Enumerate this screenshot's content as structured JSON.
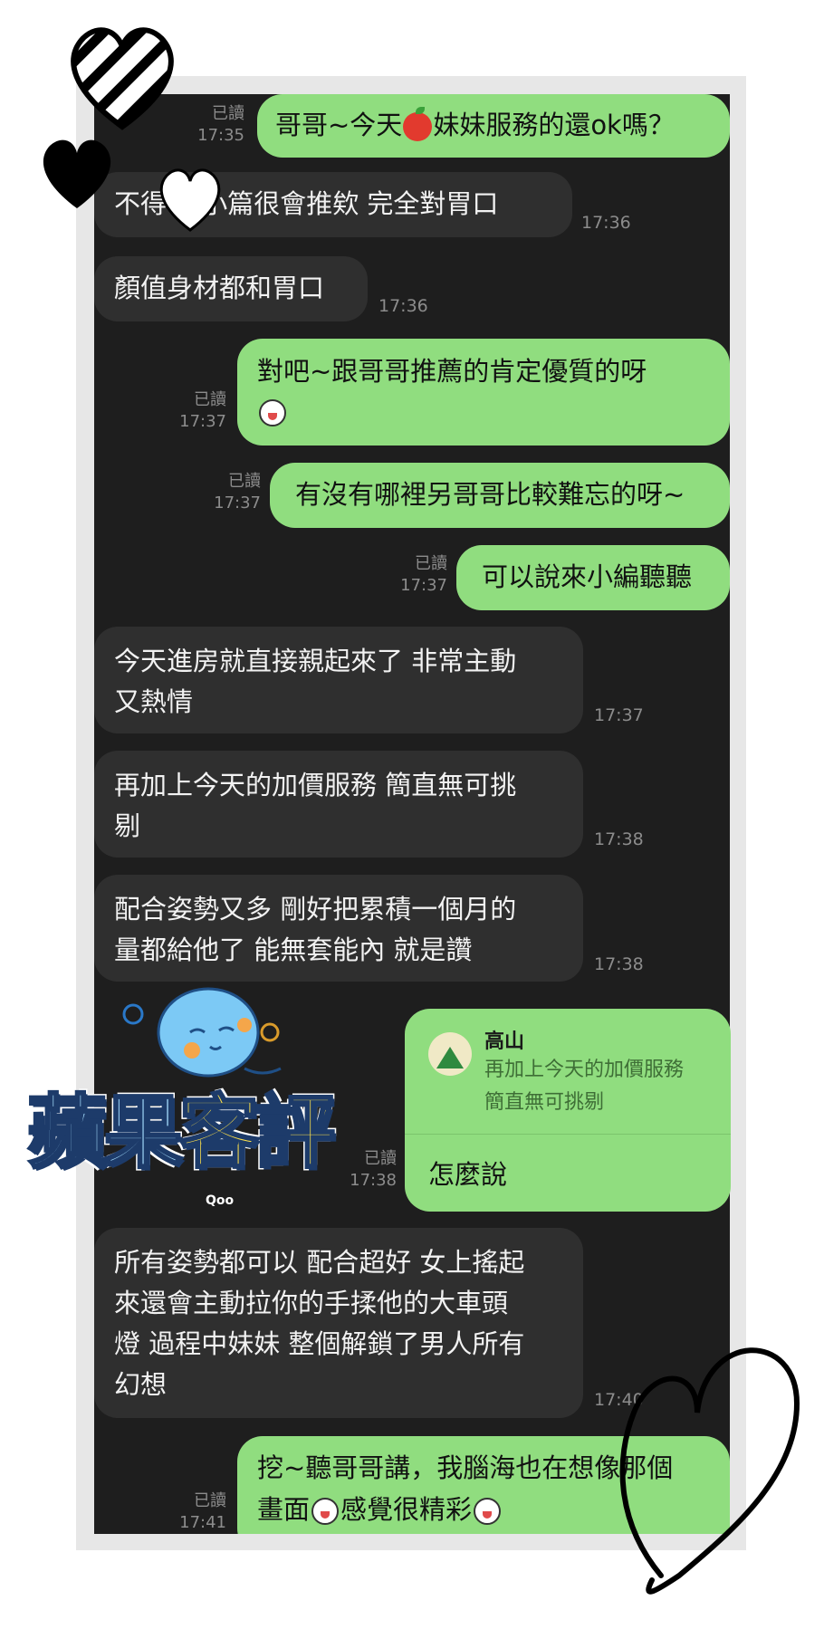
{
  "messages": [
    {
      "id": "m1",
      "side": "out",
      "text": "哥哥~今天",
      "text2": "妹妹服務的還ok嗎？",
      "read": "已讀",
      "time": "17:35"
    },
    {
      "id": "m2",
      "side": "in",
      "text": "不得了 小篇很會推欸 完全對胃口",
      "time": "17:36"
    },
    {
      "id": "m3",
      "side": "in",
      "text": "顏值身材都和胃口",
      "time": "17:36"
    },
    {
      "id": "m4",
      "side": "out",
      "text": "對吧~跟哥哥推薦的肯定優質的呀",
      "read": "已讀",
      "time": "17:37"
    },
    {
      "id": "m5",
      "side": "out",
      "text": "有沒有哪裡另哥哥比較難忘的呀~",
      "read": "已讀",
      "time": "17:37"
    },
    {
      "id": "m6",
      "side": "out",
      "text": "可以說來小編聽聽",
      "read": "已讀",
      "time": "17:37"
    },
    {
      "id": "m7",
      "side": "in",
      "lines": [
        "今天進房就直接親起來了 非常主動",
        "又熱情"
      ],
      "time": "17:37"
    },
    {
      "id": "m8",
      "side": "in",
      "lines": [
        "再加上今天的加價服務 簡直無可挑",
        "剔"
      ],
      "time": "17:38"
    },
    {
      "id": "m9",
      "side": "in",
      "lines": [
        "配合姿勢又多 剛好把累積一個月的",
        "量都給他了 能無套能內 就是讚"
      ],
      "time": "17:38"
    },
    {
      "id": "m10",
      "side": "out",
      "quote_name": "高山",
      "quote_lines": [
        "再加上今天的加價服務",
        "簡直無可挑剔"
      ],
      "reply": "怎麼說",
      "read": "已讀",
      "time": "17:38"
    },
    {
      "id": "m11",
      "side": "in",
      "lines": [
        "所有姿勢都可以 配合超好 女上搖起",
        "來還會主動拉你的手揉他的大車頭",
        "燈 過程中妹妹 整個解鎖了男人所有",
        "幻想"
      ],
      "time": "17:40"
    },
    {
      "id": "m12",
      "side": "out",
      "line1": "挖~聽哥哥講，我腦海也在想像那個",
      "line2a": "畫面",
      "line2b": "感覺很精彩",
      "read": "已讀",
      "time": "17:41"
    }
  ],
  "overlay": {
    "title_part1": "蘋果",
    "title_part2": "客評",
    "mascot_label": "Qoo",
    "icons": [
      "striped-heart-icon",
      "black-heart-icon",
      "white-heart-icon",
      "outline-heart-icon",
      "mascot-icon",
      "apple-emoji-icon",
      "smile-emoji-icon"
    ]
  },
  "colors": {
    "chat_bg": "#1e1e1e",
    "incoming": "#2f2f2f",
    "outgoing": "#90dd7f",
    "meta": "#8c8c8c"
  }
}
